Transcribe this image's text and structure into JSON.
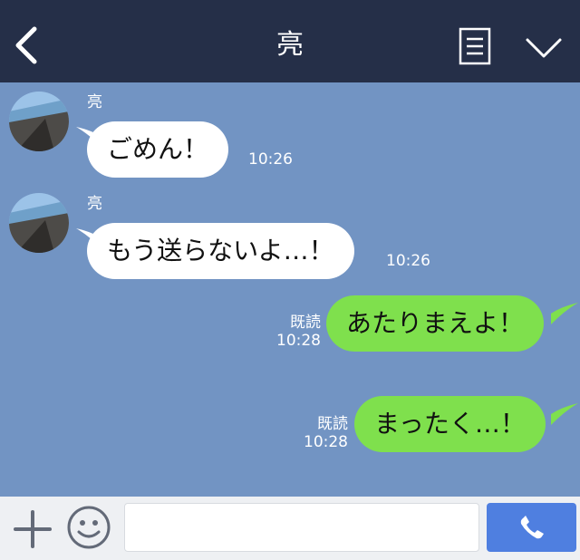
{
  "header": {
    "title": "亮",
    "back_icon": "chevron-left-icon",
    "menu_icon": "list-icon",
    "expand_icon": "chevron-down-icon",
    "background": "#252f48"
  },
  "chat": {
    "background": "#7294c3",
    "messages": [
      {
        "side": "in",
        "sender": "亮",
        "text": "ごめん！",
        "time": "10:26"
      },
      {
        "side": "in",
        "sender": "亮",
        "text": "もう送らないよ…！",
        "time": "10:26"
      },
      {
        "side": "out",
        "read": "既読",
        "text": "あたりまえよ！",
        "time": "10:28"
      },
      {
        "side": "out",
        "read": "既読",
        "text": "まったく…！",
        "time": "10:28"
      }
    ],
    "incoming_bubble_color": "#ffffff",
    "outgoing_bubble_color": "#7fe04d"
  },
  "footer": {
    "plus_icon": "plus-icon",
    "sticker_icon": "smiley-icon",
    "input_value": "",
    "input_placeholder": "",
    "call_icon": "phone-icon",
    "call_button_color": "#4f7fe0"
  }
}
